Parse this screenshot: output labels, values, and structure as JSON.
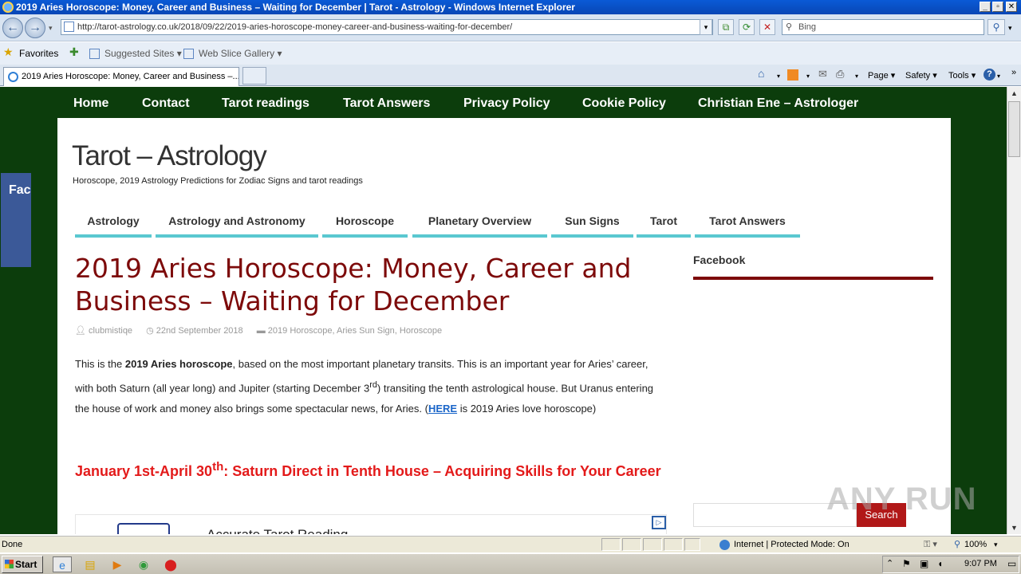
{
  "window": {
    "title": "2019 Aries Horoscope: Money, Career and Business – Waiting for December | Tarot - Astrology - Windows Internet Explorer"
  },
  "address": {
    "url": "http://tarot-astrology.co.uk/2018/09/22/2019-aries-horoscope-money-career-and-business-waiting-for-december/"
  },
  "search": {
    "placeholder": "Bing"
  },
  "favorites": {
    "label": "Favorites",
    "suggested": "Suggested Sites ▾",
    "webslice": "Web Slice Gallery ▾"
  },
  "tab": {
    "label": "2019 Aries Horoscope: Money, Career and Business –..."
  },
  "commands": {
    "page": "Page ▾",
    "safety": "Safety ▾",
    "tools": "Tools ▾"
  },
  "site": {
    "topnav": [
      "Home",
      "Contact",
      "Tarot readings",
      "Tarot Answers",
      "Privacy Policy",
      "Cookie Policy",
      "Christian Ene – Astrologer"
    ],
    "facebook_tab": "Facebo",
    "title": "Tarot – Astrology",
    "tagline": "Horoscope, 2019 Astrology Predictions for Zodiac Signs and tarot readings",
    "categories": [
      "Astrology",
      "Astrology and Astronomy",
      "Horoscope",
      "Planetary Overview",
      "Sun Signs",
      "Tarot",
      "Tarot Answers"
    ]
  },
  "post": {
    "title": "2019 Aries Horoscope: Money, Career and Business – Waiting for December",
    "author": "clubmistiqe",
    "date": "22nd September 2018",
    "tags": "2019 Horoscope, Aries Sun Sign, Horoscope",
    "p_1": "This is the ",
    "p_bold": "2019 Aries horoscope",
    "p_2": ", based on the most important planetary transits. This is an important year for Aries’ career, with both Saturn (all year long) and Jupiter (starting December 3",
    "p_sup": "rd",
    "p_3": ") transiting the tenth astrological house. But Uranus entering the house of work and money also brings some spectacular news, for Aries. (",
    "p_link": "HERE",
    "p_4": " is 2019 Aries love horoscope)",
    "h2_a": "January 1st-April 30",
    "h2_sup": "th",
    "h2_b": ": Saturn Direct in Tenth House – Acquiring Skills for Your Career",
    "ad_text": "Accurate Tarot Reading"
  },
  "sidebar": {
    "heading": "Facebook",
    "search_button": "Search"
  },
  "watermark": "ANY RUN",
  "statusbar": {
    "left": "Done",
    "zone": "Internet | Protected Mode: On",
    "zoom": "100%"
  },
  "taskbar": {
    "start": "Start",
    "clock": "9:07 PM"
  }
}
